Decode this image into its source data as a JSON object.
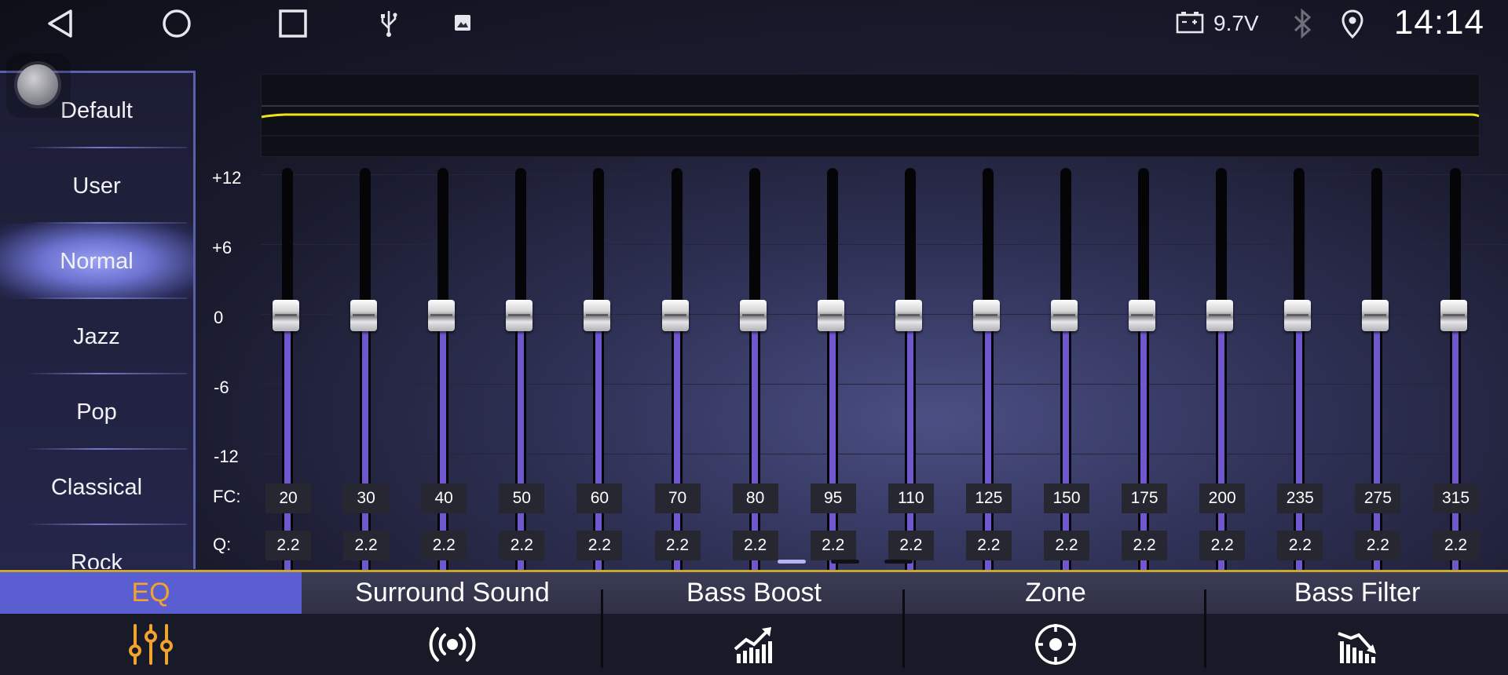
{
  "status_bar": {
    "icons": [
      "back-icon",
      "home-icon",
      "recents-icon",
      "usb-icon",
      "image-icon",
      "battery-icon",
      "bluetooth-icon",
      "location-icon"
    ],
    "voltage": "9.7V",
    "time": "14:14"
  },
  "presets": {
    "items": [
      {
        "label": "Default"
      },
      {
        "label": "User"
      },
      {
        "label": "Normal"
      },
      {
        "label": "Jazz"
      },
      {
        "label": "Pop"
      },
      {
        "label": "Classical"
      },
      {
        "label": "Rock"
      }
    ],
    "selected": "Normal"
  },
  "eq": {
    "db_labels": [
      "+12",
      "+6",
      "0",
      "-6",
      "-12"
    ],
    "fc_label": "FC:",
    "q_label": "Q:",
    "bands": [
      {
        "fc": "20",
        "q": "2.2",
        "gain_db": 0
      },
      {
        "fc": "30",
        "q": "2.2",
        "gain_db": 0
      },
      {
        "fc": "40",
        "q": "2.2",
        "gain_db": 0
      },
      {
        "fc": "50",
        "q": "2.2",
        "gain_db": 0
      },
      {
        "fc": "60",
        "q": "2.2",
        "gain_db": 0
      },
      {
        "fc": "70",
        "q": "2.2",
        "gain_db": 0
      },
      {
        "fc": "80",
        "q": "2.2",
        "gain_db": 0
      },
      {
        "fc": "95",
        "q": "2.2",
        "gain_db": 0
      },
      {
        "fc": "110",
        "q": "2.2",
        "gain_db": 0
      },
      {
        "fc": "125",
        "q": "2.2",
        "gain_db": 0
      },
      {
        "fc": "150",
        "q": "2.2",
        "gain_db": 0
      },
      {
        "fc": "175",
        "q": "2.2",
        "gain_db": 0
      },
      {
        "fc": "200",
        "q": "2.2",
        "gain_db": 0
      },
      {
        "fc": "235",
        "q": "2.2",
        "gain_db": 0
      },
      {
        "fc": "275",
        "q": "2.2",
        "gain_db": 0
      },
      {
        "fc": "315",
        "q": "2.2",
        "gain_db": 0
      }
    ],
    "curve_color": "#f2e21c",
    "slider_fill_color": "#6f58cf"
  },
  "pages": {
    "count": 3,
    "current": 1
  },
  "tabs": [
    {
      "label": "EQ",
      "icon": "equalizer-sliders-icon",
      "active": true
    },
    {
      "label": "Surround Sound",
      "icon": "broadcast-icon",
      "active": false
    },
    {
      "label": "Bass Boost",
      "icon": "bass-boost-chart-icon",
      "active": false
    },
    {
      "label": "Zone",
      "icon": "target-zone-icon",
      "active": false
    },
    {
      "label": "Bass Filter",
      "icon": "bass-filter-chart-icon",
      "active": false
    }
  ],
  "colors": {
    "accent": "#5a5ed0",
    "active_tab_text": "#f2a32e",
    "divider": "#c7a532"
  }
}
